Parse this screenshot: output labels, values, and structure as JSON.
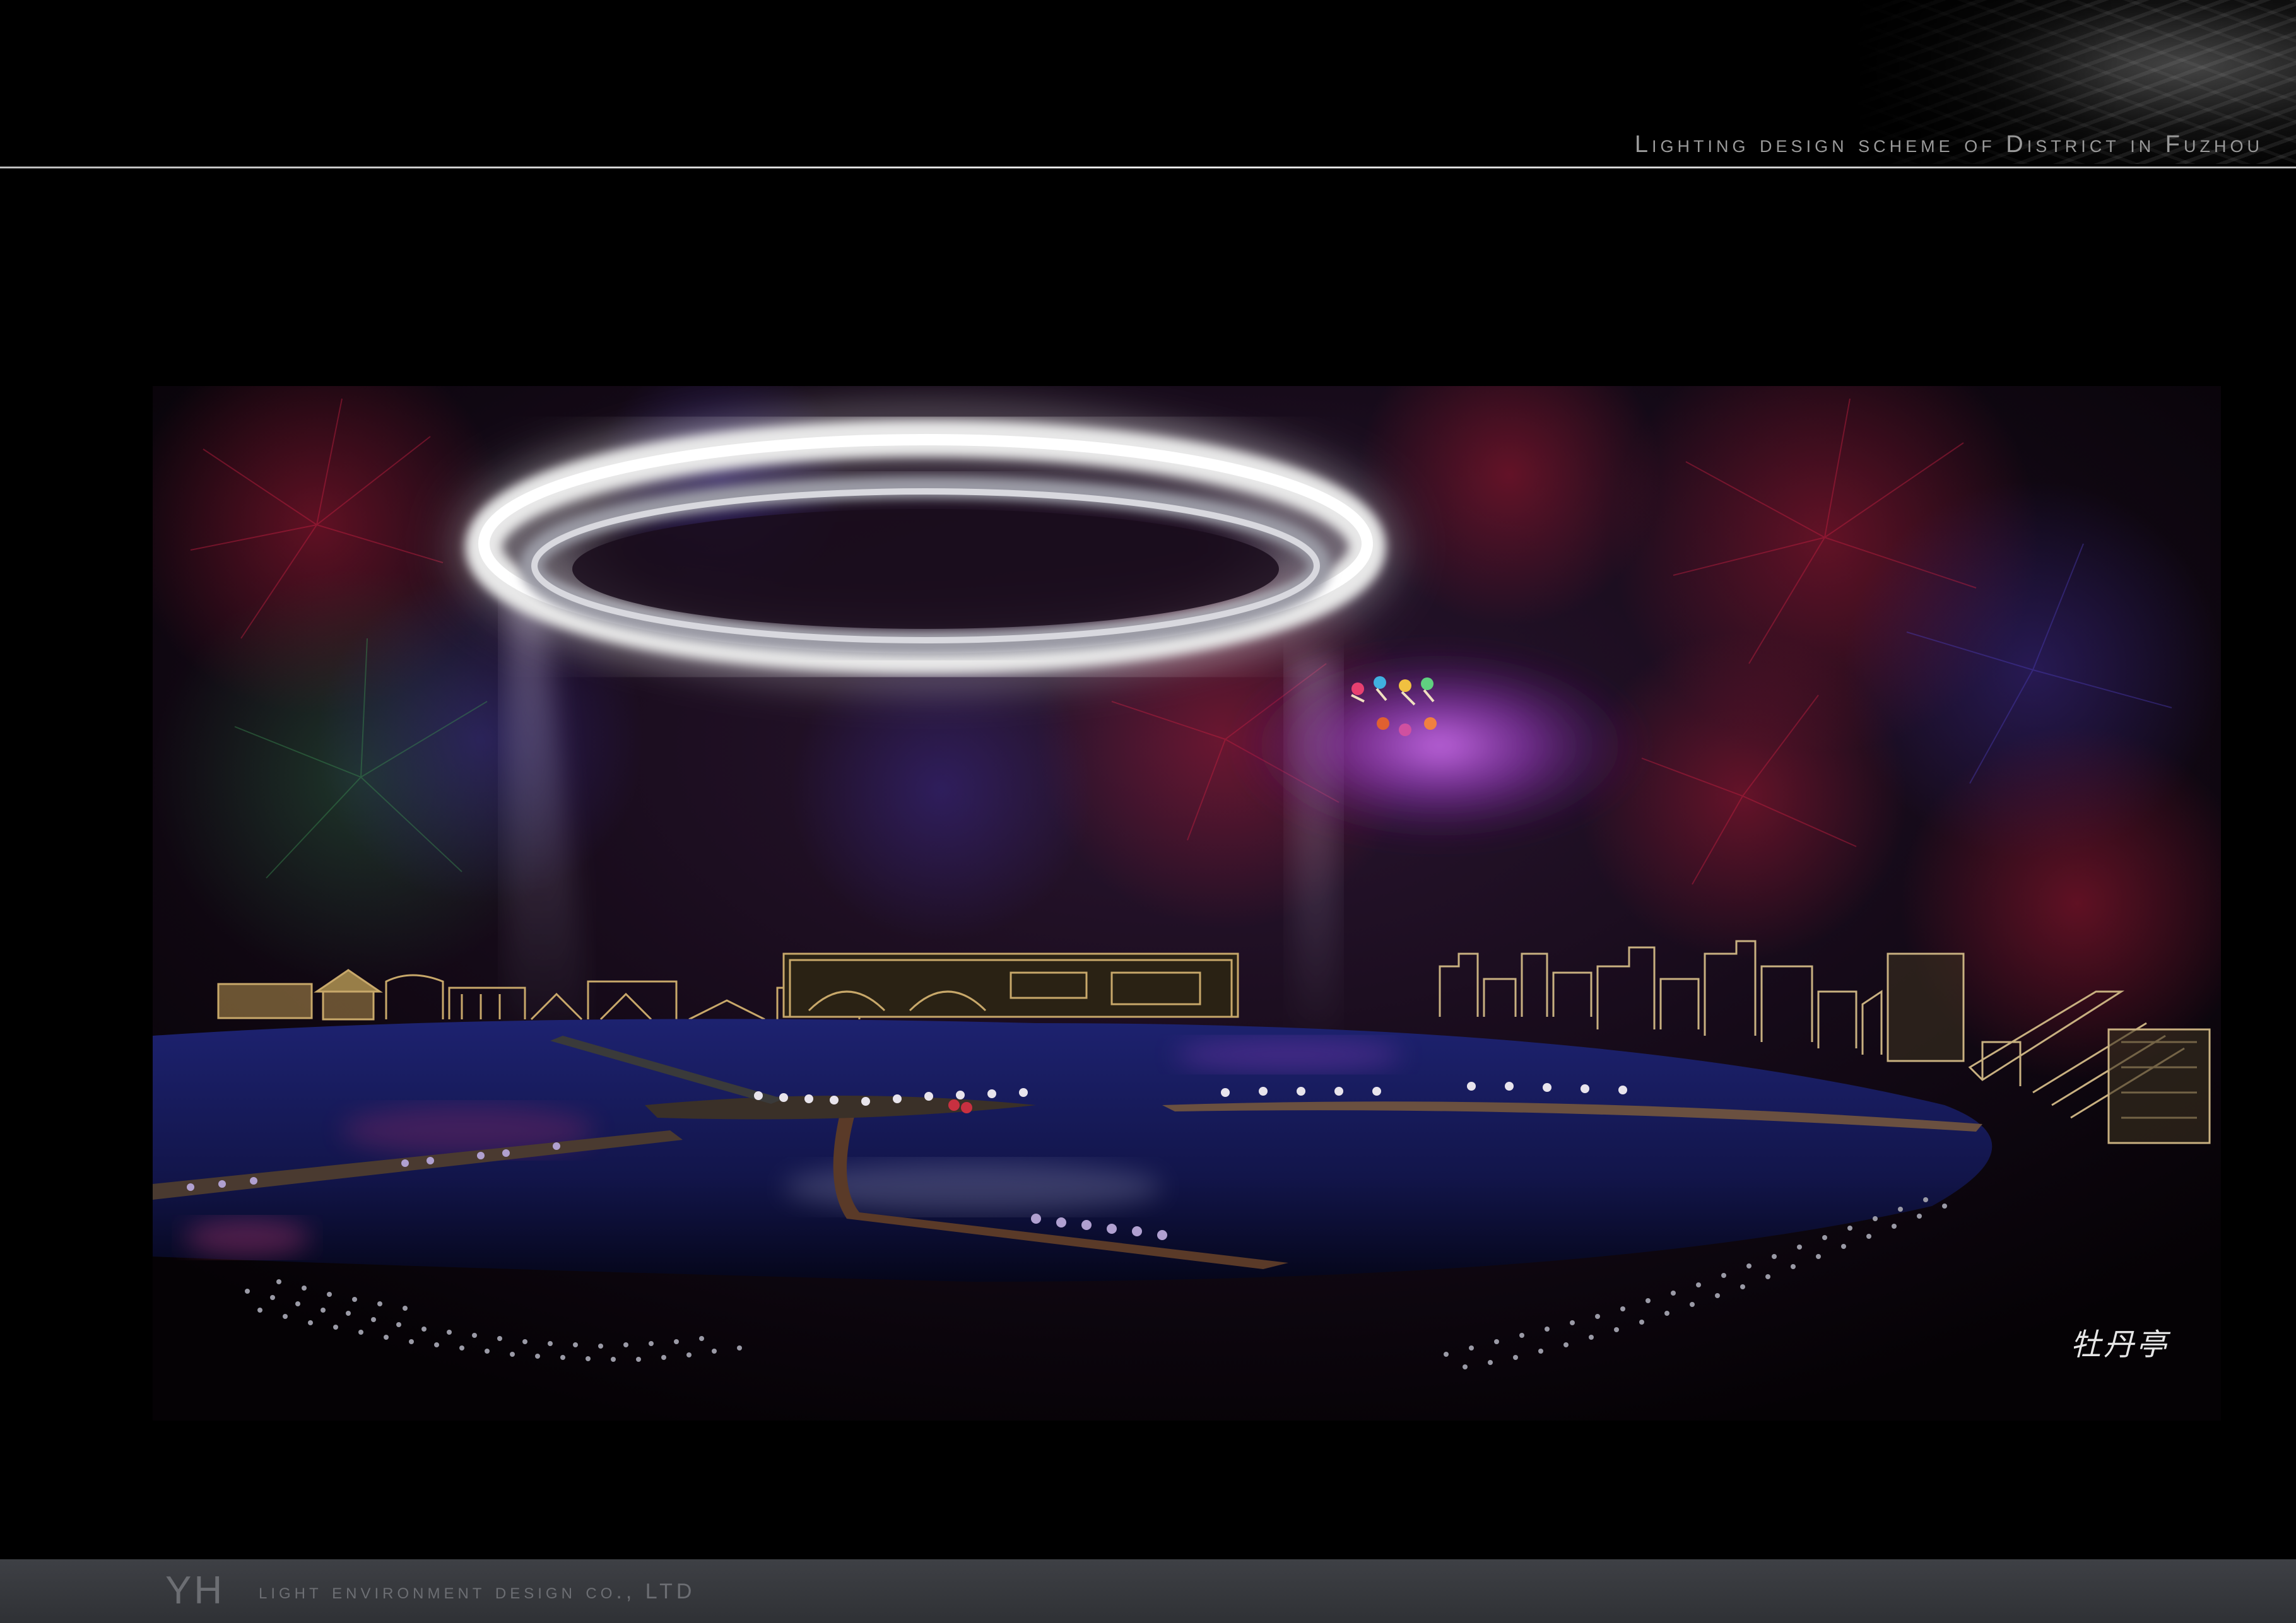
{
  "header": {
    "title": "Lighting design scheme of District in Fuzhou"
  },
  "rendering": {
    "signature": "牡丹亭"
  },
  "footer": {
    "logo": "YH",
    "company": "light environment design co., LTD"
  },
  "colors": {
    "background": "#000000",
    "footer_bar": "#393b40",
    "header_rule": "#d8d8d8",
    "ring_glow": "#f2f2f2",
    "purple_haze": "#b24fd8",
    "water": "#1a1f5c",
    "building_outline": "#c8a86a"
  }
}
